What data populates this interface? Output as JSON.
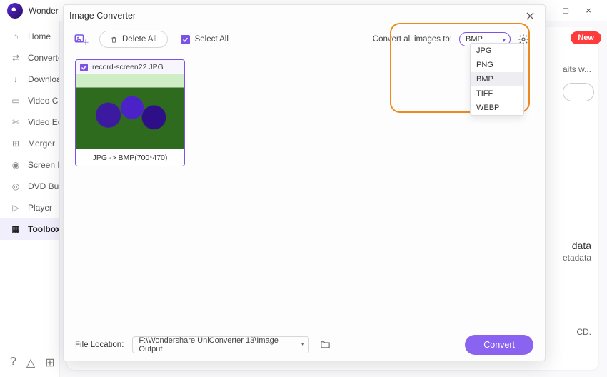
{
  "app": {
    "title": "Wonder"
  },
  "window_controls": {
    "min": "–",
    "max": "□",
    "close": "×"
  },
  "sidebar": {
    "items": [
      {
        "label": "Home",
        "icon": "home-icon"
      },
      {
        "label": "Converter",
        "icon": "converter-icon"
      },
      {
        "label": "Downloader",
        "icon": "download-icon"
      },
      {
        "label": "Video Compressor",
        "icon": "video-compress-icon"
      },
      {
        "label": "Video Editor",
        "icon": "scissors-icon"
      },
      {
        "label": "Merger",
        "icon": "merger-icon"
      },
      {
        "label": "Screen Recorder",
        "icon": "screen-record-icon"
      },
      {
        "label": "DVD Burner",
        "icon": "dvd-icon"
      },
      {
        "label": "Player",
        "icon": "player-icon"
      },
      {
        "label": "Toolbox",
        "icon": "toolbox-icon",
        "active": true
      }
    ],
    "footer_icons": [
      "help-icon",
      "bell-icon",
      "grid-icon"
    ]
  },
  "background": {
    "new_badge": "New",
    "peek_text1": "aits w...",
    "peek_heading": "data",
    "peek_sub": "etadata",
    "peek_bottom": "CD."
  },
  "modal": {
    "title": "Image Converter",
    "toolbar": {
      "delete_all": "Delete All",
      "select_all": "Select All",
      "convert_to_label": "Convert all images to:",
      "selected_format": "BMP",
      "format_options": [
        "JPG",
        "PNG",
        "BMP",
        "TIFF",
        "WEBP"
      ]
    },
    "thumb": {
      "filename": "record-screen22.JPG",
      "conversion": "JPG -> BMP(700*470)"
    },
    "footer": {
      "location_label": "File Location:",
      "path": "F:\\Wondershare UniConverter 13\\Image Output",
      "convert": "Convert"
    }
  }
}
